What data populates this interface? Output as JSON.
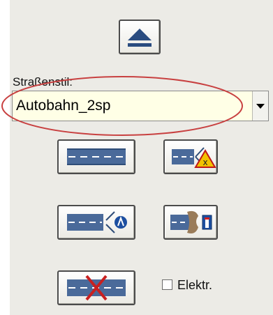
{
  "eject_button": {
    "icon": "eject-icon"
  },
  "road_style": {
    "label": "Straßenstil:",
    "selected": "Autobahn_2sp",
    "dropdown_icon": "dropdown-arrow-icon"
  },
  "buttons": {
    "road_straight": {
      "icon": "road-segment-icon"
    },
    "road_branch_warning": {
      "icon": "road-branch-warning-icon"
    },
    "road_junction": {
      "icon": "road-junction-icon"
    },
    "road_tunnel": {
      "icon": "road-tunnel-icon"
    },
    "road_delete": {
      "icon": "road-delete-icon"
    }
  },
  "elektr": {
    "label": "Elektr.",
    "checked": false
  },
  "colors": {
    "highlight_ellipse": "#c84040",
    "combo_background": "#ffffe6",
    "road_color": "#4a6a9a"
  }
}
